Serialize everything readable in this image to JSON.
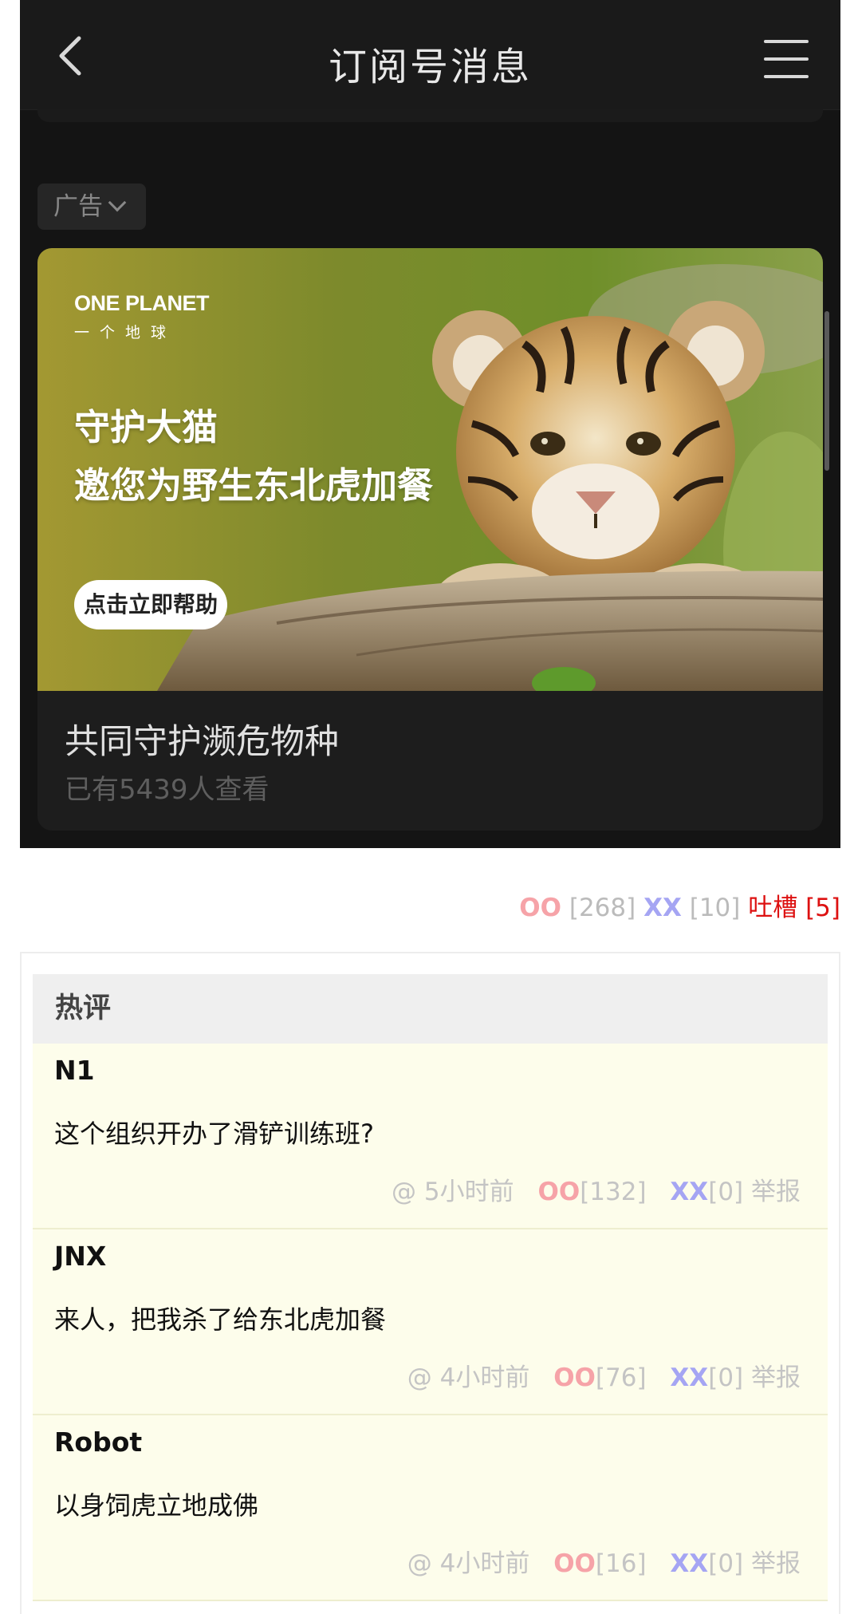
{
  "header": {
    "title": "订阅号消息",
    "back_icon": "chevron-left-icon",
    "menu_icon": "hamburger-menu-icon"
  },
  "ad": {
    "tag_label": "广告",
    "brand_en": "ONE PLANET",
    "brand_cn": "一个地球",
    "headline_line1": "守护大猫",
    "headline_line2": "邀您为野生东北虎加餐",
    "cta_label": "点击立即帮助",
    "title": "共同守护濒危物种",
    "views": "已有5439人查看"
  },
  "votes": {
    "oo_label": "OO",
    "oo_count": "[268]",
    "xx_label": "XX",
    "xx_count": "[10]",
    "tucao_label": "吐槽 [5]"
  },
  "comments_header": "热评",
  "comments": [
    {
      "author": "N1",
      "text": "这个组织开办了滑铲训练班?",
      "time": "@ 5小时前",
      "oo_label": "OO",
      "oo_count": "[132]",
      "xx_label": "XX",
      "xx_count": "[0]",
      "report": "举报"
    },
    {
      "author": "JNX",
      "text": "来人，把我杀了给东北虎加餐",
      "time": "@ 4小时前",
      "oo_label": "OO",
      "oo_count": "[76]",
      "xx_label": "XX",
      "xx_count": "[0]",
      "report": "举报"
    },
    {
      "author": "Robot",
      "text": "以身饲虎立地成佛",
      "time": "@ 4小时前",
      "oo_label": "OO",
      "oo_count": "[16]",
      "xx_label": "XX",
      "xx_count": "[0]",
      "report": "举报"
    }
  ],
  "colors": {
    "oo": "#f6a3a8",
    "xx": "#a5a5f3",
    "tucao": "#dd1111",
    "comment_bg": "#fdfdeb"
  }
}
